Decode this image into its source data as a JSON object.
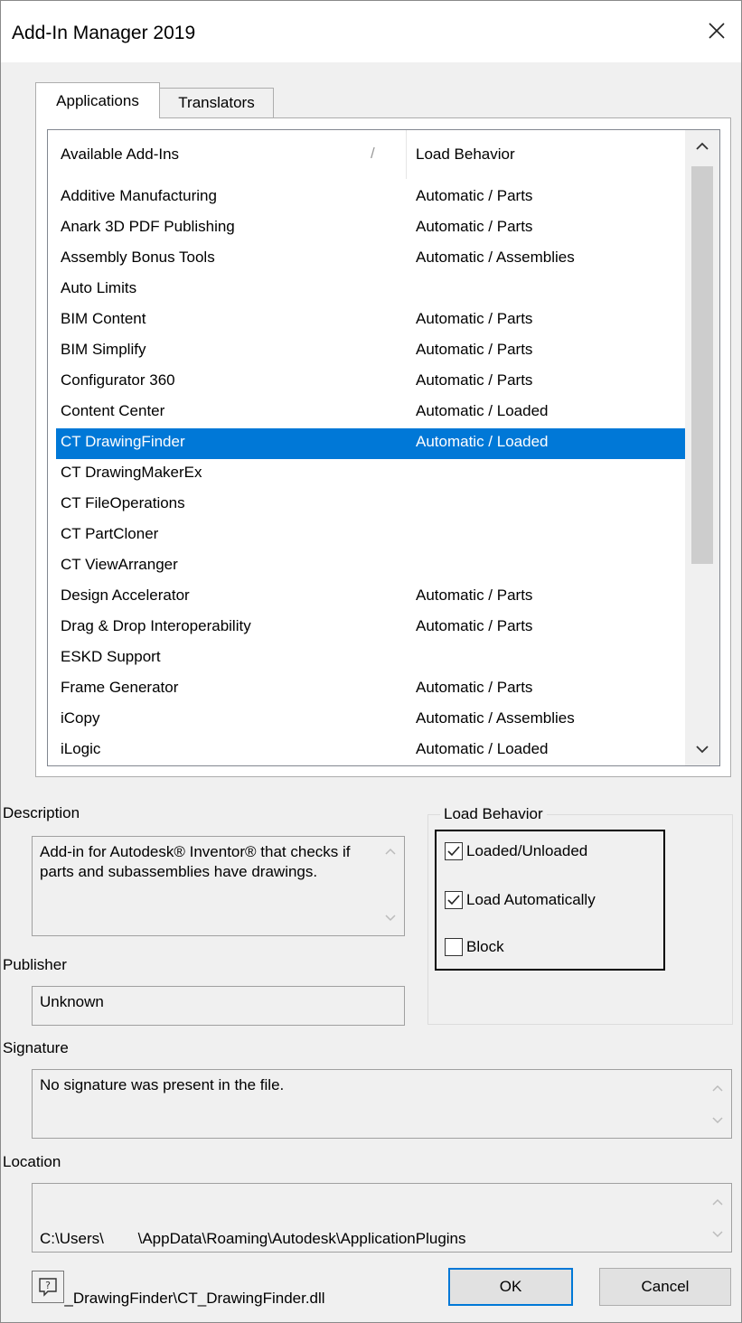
{
  "window": {
    "title": "Add-In Manager 2019"
  },
  "tabs": [
    {
      "label": "Applications",
      "active": true
    },
    {
      "label": "Translators",
      "active": false
    }
  ],
  "list": {
    "columns": [
      "Available Add-Ins",
      "Load Behavior"
    ],
    "sort_indicator": "/",
    "rows": [
      {
        "name": "Additive Manufacturing",
        "load": "Automatic / Parts"
      },
      {
        "name": "Anark 3D PDF Publishing",
        "load": "Automatic / Parts"
      },
      {
        "name": "Assembly Bonus Tools",
        "load": "Automatic / Assemblies"
      },
      {
        "name": "Auto Limits",
        "load": ""
      },
      {
        "name": "BIM Content",
        "load": "Automatic / Parts"
      },
      {
        "name": "BIM Simplify",
        "load": "Automatic / Parts"
      },
      {
        "name": "Configurator 360",
        "load": "Automatic / Parts"
      },
      {
        "name": "Content Center",
        "load": "Automatic / Loaded"
      },
      {
        "name": "CT DrawingFinder",
        "load": "Automatic / Loaded",
        "selected": true
      },
      {
        "name": "CT DrawingMakerEx",
        "load": ""
      },
      {
        "name": "CT FileOperations",
        "load": ""
      },
      {
        "name": "CT PartCloner",
        "load": ""
      },
      {
        "name": "CT ViewArranger",
        "load": ""
      },
      {
        "name": "Design Accelerator",
        "load": "Automatic / Parts"
      },
      {
        "name": "Drag & Drop Interoperability",
        "load": "Automatic / Parts"
      },
      {
        "name": "ESKD Support",
        "load": ""
      },
      {
        "name": "Frame Generator",
        "load": "Automatic / Parts"
      },
      {
        "name": "iCopy",
        "load": "Automatic / Assemblies"
      },
      {
        "name": "iLogic",
        "load": "Automatic / Loaded"
      }
    ],
    "scrollbar": {
      "up_icon": "chevron-up-icon",
      "down_icon": "chevron-down-icon"
    }
  },
  "description": {
    "label": "Description",
    "text": "Add-in for Autodesk® Inventor® that checks if parts and subassemblies have drawings."
  },
  "publisher": {
    "label": "Publisher",
    "value": "Unknown"
  },
  "signature": {
    "label": "Signature",
    "value": "No signature was present in the file."
  },
  "location": {
    "label": "Location",
    "value_line1": "C:\\Users\\        \\AppData\\Roaming\\Autodesk\\ApplicationPlugins",
    "value_line2": "\\CT_DrawingFinder\\CT_DrawingFinder.dll"
  },
  "load_behavior": {
    "label": "Load Behavior",
    "options": [
      {
        "label": "Loaded/Unloaded",
        "checked": true
      },
      {
        "label": "Load Automatically",
        "checked": true
      },
      {
        "label": "Block",
        "checked": false
      }
    ]
  },
  "buttons": {
    "ok": "OK",
    "cancel": "Cancel",
    "help_icon": "help-icon"
  },
  "colors": {
    "selection": "#0078d7",
    "default_button_border": "#0078d7"
  }
}
